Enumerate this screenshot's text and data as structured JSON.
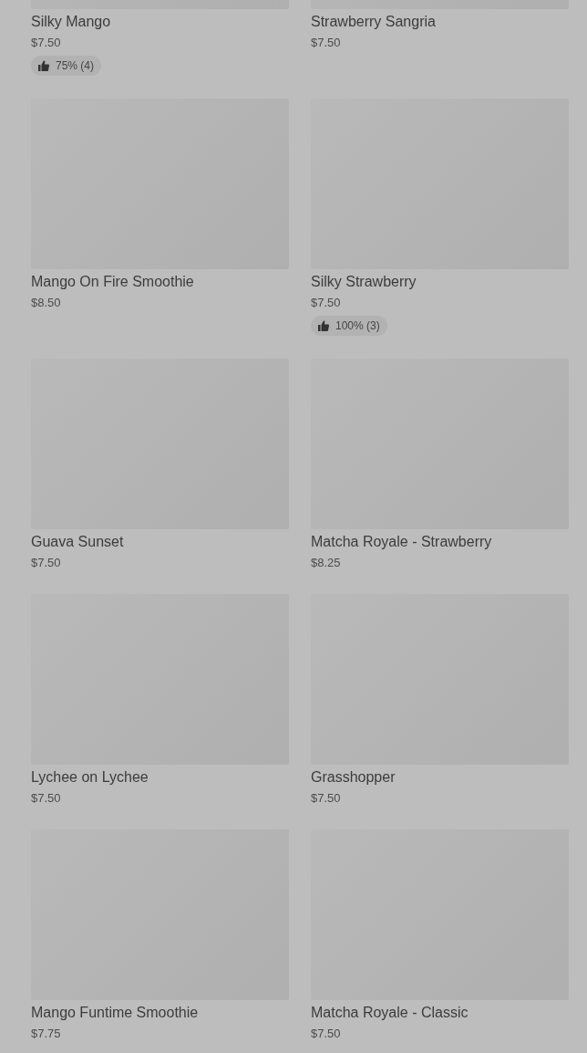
{
  "items": [
    {
      "name": "Silky Mango",
      "price": "$7.50",
      "rating": "75% (4)"
    },
    {
      "name": "Strawberry Sangria",
      "price": "$7.50"
    },
    {
      "name": "Mango On Fire Smoothie",
      "price": "$8.50"
    },
    {
      "name": "Silky Strawberry",
      "price": "$7.50",
      "rating": "100% (3)"
    },
    {
      "name": "Guava Sunset",
      "price": "$7.50"
    },
    {
      "name": "Matcha Royale - Strawberry",
      "price": "$8.25"
    },
    {
      "name": "Lychee on Lychee",
      "price": "$7.50"
    },
    {
      "name": "Grasshopper",
      "price": "$7.50"
    },
    {
      "name": "Mango Funtime Smoothie",
      "price": "$7.75"
    },
    {
      "name": "Matcha Royale - Classic",
      "price": "$7.50"
    }
  ]
}
